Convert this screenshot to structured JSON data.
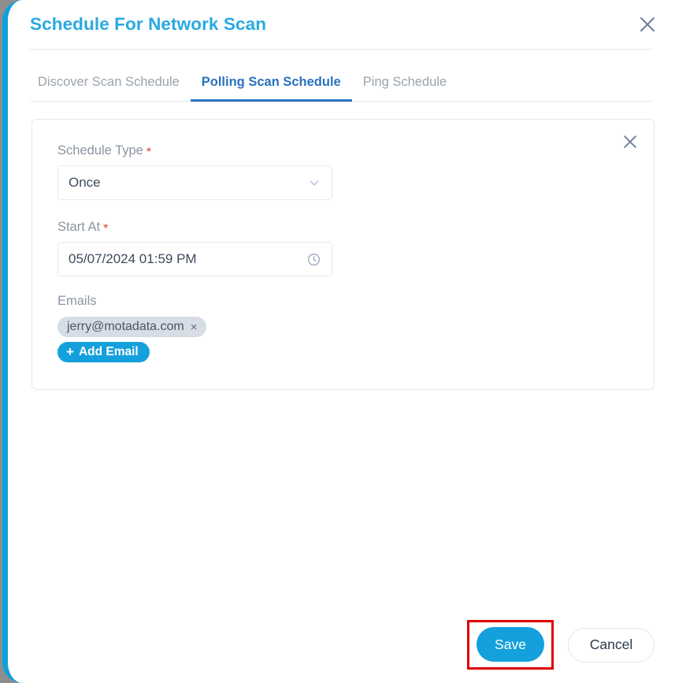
{
  "dialog": {
    "title": "Schedule For Network Scan",
    "close_icon": "close-icon"
  },
  "tabs": [
    {
      "label": "Discover Scan Schedule",
      "active": false
    },
    {
      "label": "Polling Scan Schedule",
      "active": true
    },
    {
      "label": "Ping Schedule",
      "active": false
    }
  ],
  "card": {
    "close_icon": "close-icon",
    "schedule_type": {
      "label": "Schedule Type",
      "required_marker": "*",
      "value": "Once",
      "icon": "chevron-down-icon"
    },
    "start_at": {
      "label": "Start At",
      "required_marker": "*",
      "value": "05/07/2024 01:59 PM",
      "icon": "clock-icon"
    },
    "emails": {
      "label": "Emails",
      "chips": [
        {
          "value": "jerry@motadata.com",
          "remove_icon": "×"
        }
      ],
      "add_button": {
        "plus": "+",
        "label": "Add Email"
      }
    }
  },
  "footer": {
    "save_label": "Save",
    "cancel_label": "Cancel"
  },
  "colors": {
    "title_blue": "#29a9e1",
    "active_tab_blue": "#2a72c0",
    "primary_button": "#14a0dc",
    "required_red": "#e03c31",
    "highlight_red": "#e00000",
    "accent_stripe": "#0fa0dc",
    "label_gray": "#8b95a1"
  }
}
